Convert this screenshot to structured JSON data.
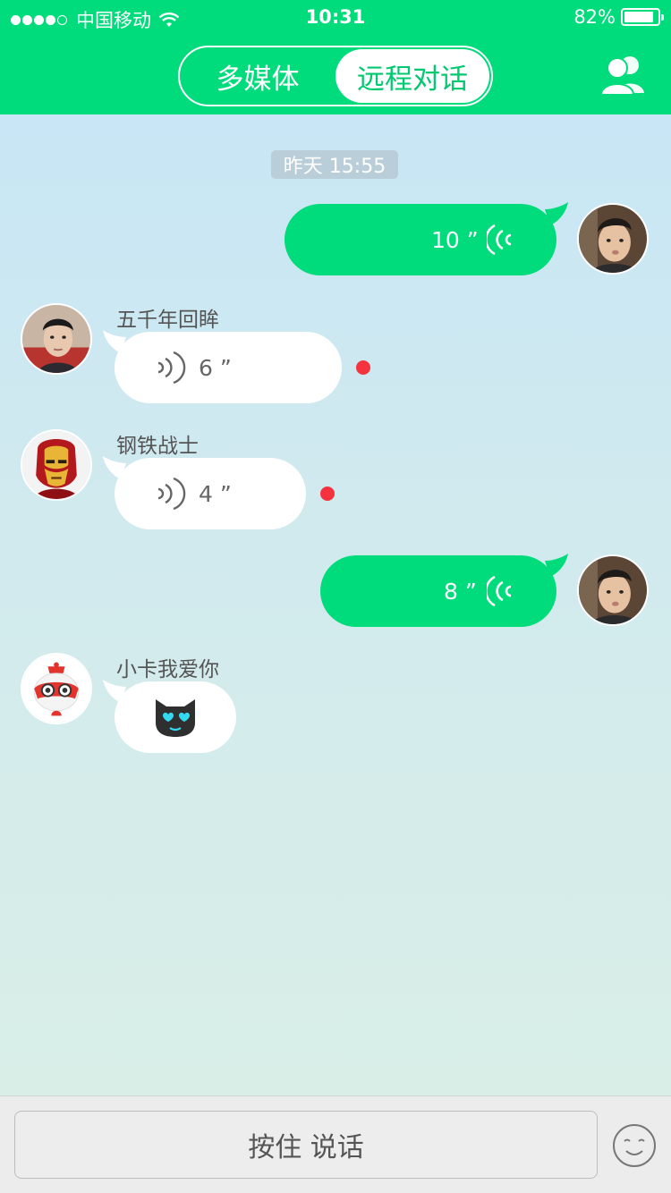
{
  "status_bar": {
    "carrier": "中国移动",
    "time": "10:31",
    "battery": "82%",
    "battery_level": 0.82
  },
  "header": {
    "tabs": [
      {
        "label": "多媒体",
        "active": false
      },
      {
        "label": "远程对话",
        "active": true
      }
    ],
    "contacts_icon": "contacts-icon"
  },
  "chat": {
    "timestamp": "昨天 15:55",
    "messages": [
      {
        "side": "out",
        "type": "voice",
        "duration": "10 ”"
      },
      {
        "side": "in",
        "sender": "五千年回眸",
        "type": "voice",
        "duration": "6 ”",
        "unread": true
      },
      {
        "side": "in",
        "sender": "钢铁战士",
        "type": "voice",
        "duration": "4 ”",
        "unread": true
      },
      {
        "side": "out",
        "type": "voice",
        "duration": "8 ”"
      },
      {
        "side": "in",
        "sender": "小卡我爱你",
        "type": "emoji",
        "icon": "heart-eyes-cat-icon"
      }
    ]
  },
  "input_bar": {
    "talk_label": "按住 说话",
    "emoji_icon": "smiley-icon"
  },
  "colors": {
    "accent": "#00dc7b",
    "unread": "#f5333f"
  }
}
